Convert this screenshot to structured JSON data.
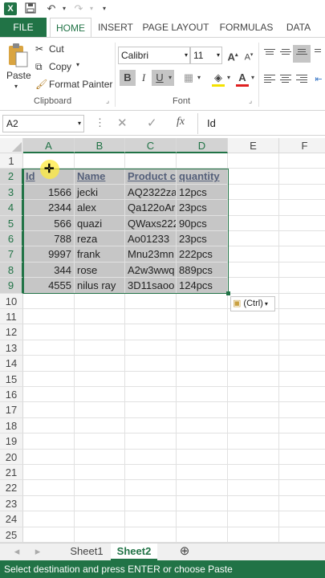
{
  "quick_access": {
    "save_icon": "save-icon",
    "undo_icon": "undo-icon",
    "redo_icon": "redo-icon"
  },
  "tabs": [
    {
      "label": "FILE"
    },
    {
      "label": "HOME"
    },
    {
      "label": "INSERT"
    },
    {
      "label": "PAGE LAYOUT"
    },
    {
      "label": "FORMULAS"
    },
    {
      "label": "DATA"
    }
  ],
  "ribbon": {
    "clipboard": {
      "paste": "Paste",
      "cut": "Cut",
      "copy": "Copy",
      "format_painter": "Format Painter",
      "group_label": "Clipboard"
    },
    "font": {
      "name": "Calibri",
      "size": "11",
      "bold": "B",
      "italic": "I",
      "underline": "U",
      "group_label": "Font"
    }
  },
  "formula_bar": {
    "name_box": "A2",
    "fx": "fx",
    "content": "Id"
  },
  "sheet": {
    "columns": [
      "A",
      "B",
      "C",
      "D",
      "E",
      "F"
    ],
    "rows": [
      "1",
      "2",
      "3",
      "4",
      "5",
      "6",
      "7",
      "8",
      "9",
      "10",
      "11",
      "12",
      "13",
      "14",
      "15",
      "16",
      "17",
      "18",
      "19",
      "20",
      "21",
      "22",
      "23",
      "24",
      "25"
    ],
    "headers": [
      "Id",
      "Name",
      "Product code",
      "quantity"
    ],
    "data": [
      [
        "1566",
        "jecki",
        "AQ2322za",
        "12pcs"
      ],
      [
        "2344",
        "alex",
        "Qa122oAr",
        "23pcs"
      ],
      [
        "566",
        "quazi",
        "QWaxs222",
        "90pcs"
      ],
      [
        "788",
        "reza",
        "Ao01233",
        "23pcs"
      ],
      [
        "9997",
        "frank",
        "Mnu23mn",
        "222pcs"
      ],
      [
        "344",
        "rose",
        "A2w3wwq",
        "889pcs"
      ],
      [
        "4555",
        "nilus ray",
        "3D11saoo",
        "124pcs"
      ]
    ],
    "paste_options": "(Ctrl)"
  },
  "sheet_tabs": [
    "Sheet1",
    "Sheet2"
  ],
  "status_text": "Select destination and press ENTER or choose Paste",
  "colors": {
    "accent": "#217346",
    "selection": "#c6c6c6"
  }
}
